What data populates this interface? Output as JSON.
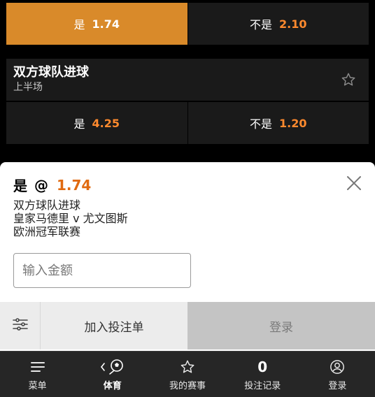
{
  "markets": {
    "top_row": {
      "yes": {
        "label": "是",
        "odds": "1.74"
      },
      "no": {
        "label": "不是",
        "odds": "2.10"
      }
    },
    "btts": {
      "title": "双方球队进球",
      "subtitle": "上半场",
      "yes": {
        "label": "是",
        "odds": "4.25"
      },
      "no": {
        "label": "不是",
        "odds": "1.20"
      }
    }
  },
  "betslip": {
    "selection": "是",
    "at": "@",
    "odds": "1.74",
    "market": "双方球队进球",
    "match": "皇家马德里 v 尤文图斯",
    "competition": "欧洲冠军联赛",
    "amount_placeholder": "输入金额",
    "add_label": "加入投注单",
    "login_label": "登录"
  },
  "nav": {
    "items": [
      {
        "label": "菜单",
        "icon": "menu-icon"
      },
      {
        "label": "体育",
        "icon": "soccer-ball-icon"
      },
      {
        "label": "我的赛事",
        "icon": "star-icon"
      },
      {
        "label": "投注记录",
        "count": "0"
      },
      {
        "label": "登录",
        "icon": "user-icon"
      }
    ]
  },
  "colors": {
    "accent": "#d98a2a",
    "odds_orange": "#ff8a2e",
    "odds_dark": "#e06a10",
    "panel": "#1a1a1a"
  }
}
